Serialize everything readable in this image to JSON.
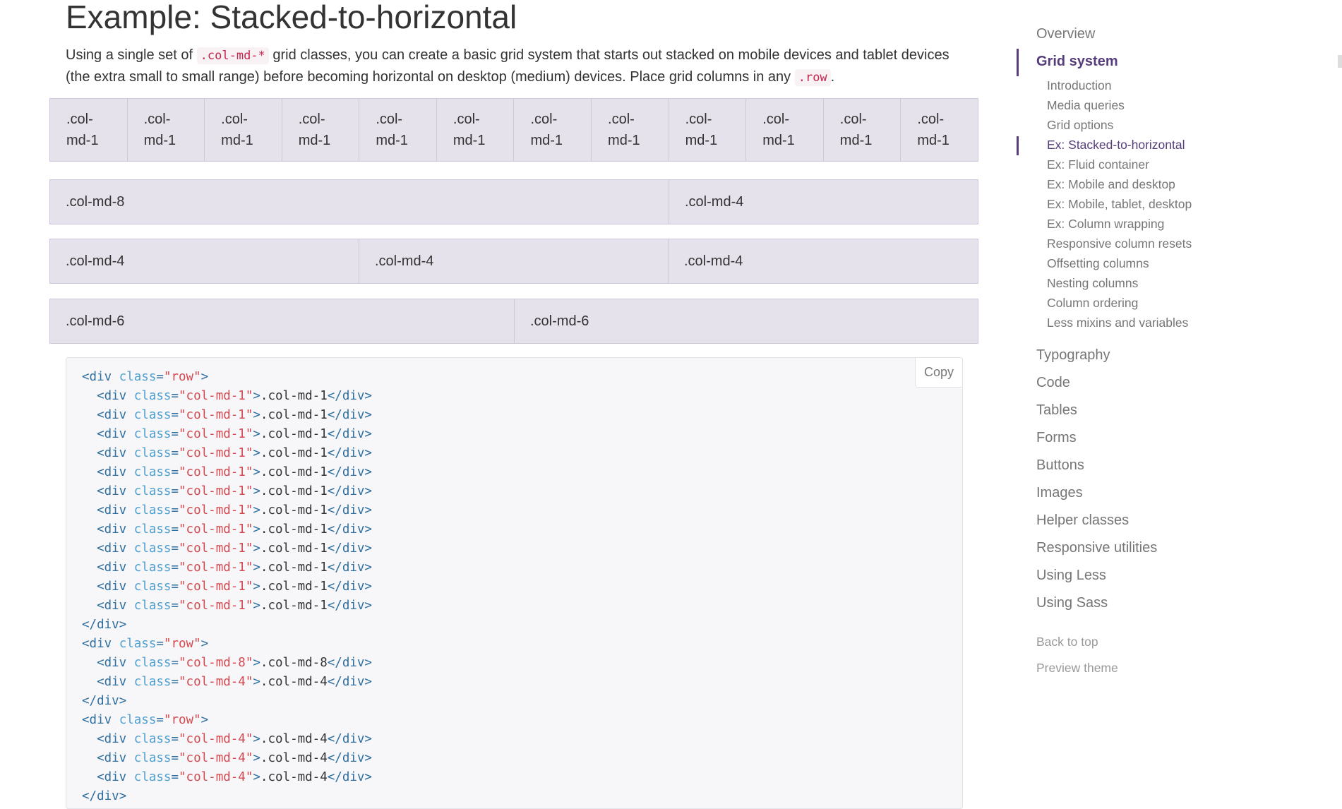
{
  "main": {
    "title": "Example: Stacked-to-horizontal",
    "intro": {
      "part1": "Using a single set of ",
      "code1": ".col-md-*",
      "part2": " grid classes, you can create a basic grid system that starts out stacked on mobile devices and tablet devices (the extra small to small range) before becoming horizontal on desktop (medium) devices. Place grid columns in any ",
      "code2": ".row",
      "part3": "."
    },
    "rows": [
      [
        ".col-md-1",
        ".col-md-1",
        ".col-md-1",
        ".col-md-1",
        ".col-md-1",
        ".col-md-1",
        ".col-md-1",
        ".col-md-1",
        ".col-md-1",
        ".col-md-1",
        ".col-md-1",
        ".col-md-1"
      ],
      [
        ".col-md-8",
        ".col-md-4"
      ],
      [
        ".col-md-4",
        ".col-md-4",
        ".col-md-4"
      ],
      [
        ".col-md-6",
        ".col-md-6"
      ]
    ],
    "copy_label": "Copy",
    "code_lines": [
      "<div class=\"row\">",
      "  <div class=\"col-md-1\">.col-md-1</div>",
      "  <div class=\"col-md-1\">.col-md-1</div>",
      "  <div class=\"col-md-1\">.col-md-1</div>",
      "  <div class=\"col-md-1\">.col-md-1</div>",
      "  <div class=\"col-md-1\">.col-md-1</div>",
      "  <div class=\"col-md-1\">.col-md-1</div>",
      "  <div class=\"col-md-1\">.col-md-1</div>",
      "  <div class=\"col-md-1\">.col-md-1</div>",
      "  <div class=\"col-md-1\">.col-md-1</div>",
      "  <div class=\"col-md-1\">.col-md-1</div>",
      "  <div class=\"col-md-1\">.col-md-1</div>",
      "  <div class=\"col-md-1\">.col-md-1</div>",
      "</div>",
      "<div class=\"row\">",
      "  <div class=\"col-md-8\">.col-md-8</div>",
      "  <div class=\"col-md-4\">.col-md-4</div>",
      "</div>",
      "<div class=\"row\">",
      "  <div class=\"col-md-4\">.col-md-4</div>",
      "  <div class=\"col-md-4\">.col-md-4</div>",
      "  <div class=\"col-md-4\">.col-md-4</div>",
      "</div>"
    ]
  },
  "sidebar": {
    "overview": "Overview",
    "grid_system": "Grid system",
    "sub_items": [
      "Introduction",
      "Media queries",
      "Grid options",
      "Ex: Stacked-to-horizontal",
      "Ex: Fluid container",
      "Ex: Mobile and desktop",
      "Ex: Mobile, tablet, desktop",
      "Ex: Column wrapping",
      "Responsive column resets",
      "Offsetting columns",
      "Nesting columns",
      "Column ordering",
      "Less mixins and variables"
    ],
    "active_sub_index": 3,
    "sections": [
      "Typography",
      "Code",
      "Tables",
      "Forms",
      "Buttons",
      "Images",
      "Helper classes",
      "Responsive utilities",
      "Using Less",
      "Using Sass"
    ],
    "back_to_top": "Back to top",
    "preview_theme": "Preview theme"
  },
  "colors": {
    "accent": "#563d7c",
    "grid_cell": "#e6e2ec",
    "grid_border": "#cfc8dc",
    "code_string": "#d44950",
    "code_tag": "#2f6f9f"
  }
}
